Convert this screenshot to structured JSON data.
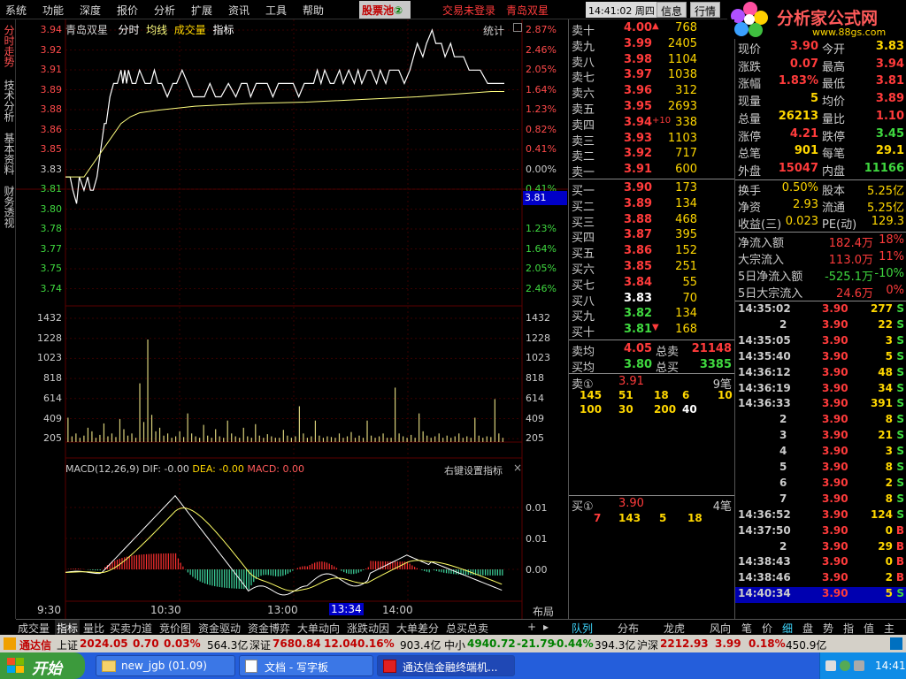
{
  "menu": [
    "系统",
    "功能",
    "深度",
    "报价",
    "分析",
    "扩展",
    "资讯",
    "工具",
    "帮助"
  ],
  "stockpool": "股票池",
  "stockpool_badge": "②",
  "trade_status": "交易未登录",
  "stock_name": "青岛双星",
  "clock": "14:41:02 周四",
  "toolbar": [
    "信息",
    "行情"
  ],
  "logo": {
    "text": "分析家公式网",
    "url": "www.88gs.com"
  },
  "side_tabs": [
    "分时走势",
    "技术分析",
    "基本资料",
    "财务透视"
  ],
  "chart": {
    "name": "青岛双星",
    "mode": "分时",
    "avg": "均线",
    "vol": "成交量",
    "ind": "指标",
    "stat": "统计",
    "left_axis": [
      "3.94",
      "3.92",
      "3.91",
      "3.89",
      "3.88",
      "3.86",
      "3.85",
      "3.83",
      "3.81",
      "3.80",
      "3.78",
      "3.77",
      "3.75",
      "3.74"
    ],
    "right_axis": [
      "2.87%",
      "2.46%",
      "2.05%",
      "1.64%",
      "1.23%",
      "0.82%",
      "0.41%",
      "0.00%",
      "0.41%",
      "0.82%",
      "1.23%",
      "1.64%",
      "2.05%",
      "2.46%"
    ],
    "cursor_price": "3.81",
    "vol_axis": [
      "1432",
      "1228",
      "1023",
      "818",
      "614",
      "409",
      "205"
    ],
    "macd_label": "MACD(12,26,9)",
    "dif": "DIF: -0.00",
    "dea": "DEA: -0.00",
    "macd": "MACD: 0.00",
    "right_click": "右键设置指标",
    "macd_axis": [
      "0.01",
      "0.01",
      "0.00"
    ],
    "time_axis": [
      "9:30",
      "10:30",
      "13:00",
      "13:34",
      "14:00"
    ],
    "layout": "布局"
  },
  "chart_data": {
    "type": "line",
    "price_x": [
      0,
      5,
      8,
      12,
      15,
      20,
      24,
      27,
      30,
      34,
      36,
      38,
      40,
      42,
      44,
      46,
      48,
      52,
      56,
      60,
      62,
      64,
      66,
      68,
      72,
      76,
      80,
      86,
      92,
      96,
      100,
      104,
      110,
      116,
      120,
      126,
      132,
      138,
      144,
      150,
      156,
      162,
      168,
      176,
      184,
      190,
      196,
      200,
      206,
      212,
      218,
      224,
      230,
      236,
      240,
      246,
      252,
      258,
      262,
      268,
      272,
      276,
      280,
      286,
      290,
      296,
      300,
      306,
      312,
      316,
      320,
      326,
      330,
      336,
      340,
      346,
      350,
      356,
      360,
      366,
      372,
      376,
      380,
      386,
      390,
      396,
      400,
      406,
      410,
      416,
      420,
      426,
      430,
      436,
      440,
      448,
      456,
      474
    ],
    "price_y": [
      3.83,
      3.83,
      3.82,
      3.81,
      3.83,
      3.82,
      3.83,
      3.82,
      3.82,
      3.83,
      3.84,
      3.85,
      3.86,
      3.87,
      3.87,
      3.88,
      3.89,
      3.9,
      3.9,
      3.91,
      3.9,
      3.91,
      3.9,
      3.91,
      3.9,
      3.9,
      3.91,
      3.9,
      3.9,
      3.91,
      3.9,
      3.9,
      3.89,
      3.9,
      3.9,
      3.91,
      3.9,
      3.89,
      3.89,
      3.89,
      3.9,
      3.89,
      3.89,
      3.9,
      3.89,
      3.9,
      3.9,
      3.89,
      3.9,
      3.9,
      3.9,
      3.89,
      3.9,
      3.9,
      3.9,
      3.9,
      3.89,
      3.9,
      3.9,
      3.9,
      3.91,
      3.9,
      3.91,
      3.9,
      3.9,
      3.91,
      3.9,
      3.91,
      3.9,
      3.91,
      3.9,
      3.91,
      3.91,
      3.9,
      3.91,
      3.9,
      3.91,
      3.91,
      3.91,
      3.9,
      3.91,
      3.92,
      3.93,
      3.92,
      3.93,
      3.94,
      3.93,
      3.93,
      3.92,
      3.93,
      3.92,
      3.92,
      3.92,
      3.91,
      3.91,
      3.91,
      3.9,
      3.9
    ],
    "avg_x": [
      0,
      10,
      20,
      30,
      40,
      50,
      60,
      70,
      80,
      100,
      140,
      200,
      260,
      320,
      380,
      420,
      460,
      474
    ],
    "avg_y": [
      3.83,
      3.83,
      3.83,
      3.84,
      3.85,
      3.86,
      3.87,
      3.875,
      3.878,
      3.88,
      3.883,
      3.885,
      3.886,
      3.888,
      3.89,
      3.892,
      3.894,
      3.894
    ],
    "ylim": [
      3.74,
      3.94
    ],
    "volume": [
      340,
      80,
      120,
      60,
      90,
      200,
      150,
      60,
      100,
      260,
      80,
      120,
      70,
      320,
      180,
      90,
      120,
      60,
      820,
      280,
      1432,
      380,
      150,
      200,
      90,
      120,
      60,
      80,
      150,
      70,
      400,
      120,
      80,
      60,
      240,
      90,
      60,
      180,
      80,
      60,
      300,
      120,
      80,
      60,
      200,
      80,
      60,
      250,
      90,
      60,
      110,
      80,
      60,
      60,
      170,
      90,
      60,
      80,
      500,
      120,
      60,
      80,
      300,
      90,
      60,
      80,
      70,
      60,
      120,
      60,
      80,
      140,
      60,
      90,
      60,
      300,
      90,
      60,
      80,
      120,
      60,
      60,
      760,
      120,
      80,
      60,
      100,
      60,
      400,
      150,
      90,
      60,
      80,
      120,
      60,
      90,
      60,
      80,
      120,
      60,
      80,
      60,
      340,
      90,
      60,
      80,
      70,
      600,
      120,
      60
    ],
    "vol_max": 1432
  },
  "asks": [
    {
      "label": "卖十",
      "price": "4.00",
      "vol": "768",
      "extra": "▲"
    },
    {
      "label": "卖九",
      "price": "3.99",
      "vol": "2405",
      "extra": ""
    },
    {
      "label": "卖八",
      "price": "3.98",
      "vol": "1104",
      "extra": ""
    },
    {
      "label": "卖七",
      "price": "3.97",
      "vol": "1038",
      "extra": ""
    },
    {
      "label": "卖六",
      "price": "3.96",
      "vol": "312",
      "extra": ""
    },
    {
      "label": "卖五",
      "price": "3.95",
      "vol": "2693",
      "extra": ""
    },
    {
      "label": "卖四",
      "price": "3.94",
      "vol": "338",
      "extra": "+10"
    },
    {
      "label": "卖三",
      "price": "3.93",
      "vol": "1103",
      "extra": ""
    },
    {
      "label": "卖二",
      "price": "3.92",
      "vol": "717",
      "extra": ""
    },
    {
      "label": "卖一",
      "price": "3.91",
      "vol": "600",
      "extra": ""
    }
  ],
  "bids": [
    {
      "label": "买一",
      "price": "3.90",
      "vol": "173",
      "extra": ""
    },
    {
      "label": "买二",
      "price": "3.89",
      "vol": "134",
      "extra": ""
    },
    {
      "label": "买三",
      "price": "3.88",
      "vol": "468",
      "extra": ""
    },
    {
      "label": "买四",
      "price": "3.87",
      "vol": "395",
      "extra": ""
    },
    {
      "label": "买五",
      "price": "3.86",
      "vol": "152",
      "extra": ""
    },
    {
      "label": "买六",
      "price": "3.85",
      "vol": "251",
      "extra": ""
    },
    {
      "label": "买七",
      "price": "3.84",
      "vol": "55",
      "extra": ""
    },
    {
      "label": "买八",
      "price": "3.83",
      "vol": "70",
      "extra": ""
    },
    {
      "label": "买九",
      "price": "3.82",
      "vol": "134",
      "extra": ""
    },
    {
      "label": "买十",
      "price": "3.81",
      "vol": "168",
      "extra": "▼"
    }
  ],
  "avg_sell": {
    "label": "卖均",
    "price": "4.05",
    "tlabel": "总卖",
    "total": "21148"
  },
  "avg_buy": {
    "label": "买均",
    "price": "3.80",
    "tlabel": "总买",
    "total": "3385"
  },
  "sell1_queue": {
    "label": "卖①",
    "price": "3.91",
    "count": "9笔",
    "row1": [
      "145",
      "51",
      "18",
      "6",
      "10"
    ],
    "row2": [
      "100",
      "30",
      "200",
      "40"
    ]
  },
  "buy1_queue": {
    "label": "买①",
    "price": "3.90",
    "count": "4笔",
    "row1": [
      "7",
      "143",
      "5",
      "18"
    ]
  },
  "info": [
    {
      "l1": "现价",
      "v1": "3.90",
      "l2": "今开",
      "v2": "3.83"
    },
    {
      "l1": "涨跌",
      "v1": "0.07",
      "l2": "最高",
      "v2": "3.94"
    },
    {
      "l1": "涨幅",
      "v1": "1.83%",
      "l2": "最低",
      "v2": "3.81"
    },
    {
      "l1": "现量",
      "v1": "5",
      "l2": "均价",
      "v2": "3.89"
    },
    {
      "l1": "总量",
      "v1": "26213",
      "l2": "量比",
      "v2": "1.10"
    },
    {
      "l1": "涨停",
      "v1": "4.21",
      "l2": "跌停",
      "v2": "3.45"
    },
    {
      "l1": "总笔",
      "v1": "901",
      "l2": "每笔",
      "v2": "29.1"
    },
    {
      "l1": "外盘",
      "v1": "15047",
      "l2": "内盘",
      "v2": "11166"
    }
  ],
  "info2": [
    {
      "l1": "换手",
      "v1": "0.50%",
      "l2": "股本",
      "v2": "5.25亿"
    },
    {
      "l1": "净资",
      "v1": "2.93",
      "l2": "流通",
      "v2": "5.25亿"
    },
    {
      "l1": "收益(三)",
      "v1": "0.023",
      "l2": "PE(动)",
      "v2": "129.3"
    }
  ],
  "flow": [
    {
      "l": "净流入额",
      "v": "182.4万",
      "p": "18%"
    },
    {
      "l": "大宗流入",
      "v": "113.0万",
      "p": "11%"
    },
    {
      "l": "5日净流入额",
      "v": "-525.1万",
      "p": "-10%"
    },
    {
      "l": "5日大宗流入",
      "v": "24.6万",
      "p": "0%"
    }
  ],
  "ticks": [
    {
      "t": "14:35:02",
      "p": "3.90",
      "v": "277",
      "s": "S"
    },
    {
      "t": "2",
      "p": "3.90",
      "v": "22",
      "s": "S"
    },
    {
      "t": "14:35:05",
      "p": "3.90",
      "v": "3",
      "s": "S"
    },
    {
      "t": "14:35:40",
      "p": "3.90",
      "v": "5",
      "s": "S"
    },
    {
      "t": "14:36:12",
      "p": "3.90",
      "v": "48",
      "s": "S"
    },
    {
      "t": "14:36:19",
      "p": "3.90",
      "v": "34",
      "s": "S"
    },
    {
      "t": "14:36:33",
      "p": "3.90",
      "v": "391",
      "s": "S"
    },
    {
      "t": "2",
      "p": "3.90",
      "v": "8",
      "s": "S"
    },
    {
      "t": "3",
      "p": "3.90",
      "v": "21",
      "s": "S"
    },
    {
      "t": "4",
      "p": "3.90",
      "v": "3",
      "s": "S"
    },
    {
      "t": "5",
      "p": "3.90",
      "v": "8",
      "s": "S"
    },
    {
      "t": "6",
      "p": "3.90",
      "v": "2",
      "s": "S"
    },
    {
      "t": "7",
      "p": "3.90",
      "v": "8",
      "s": "S"
    },
    {
      "t": "14:36:52",
      "p": "3.90",
      "v": "124",
      "s": "S"
    },
    {
      "t": "14:37:50",
      "p": "3.90",
      "v": "0",
      "s": "B"
    },
    {
      "t": "2",
      "p": "3.90",
      "v": "29",
      "s": "B"
    },
    {
      "t": "14:38:43",
      "p": "3.90",
      "v": "0",
      "s": "B"
    },
    {
      "t": "14:38:46",
      "p": "3.90",
      "v": "2",
      "s": "B"
    },
    {
      "t": "14:40:34",
      "p": "3.90",
      "v": "5",
      "s": "S"
    }
  ],
  "bottom_tabs": [
    "成交量",
    "指标",
    "量比",
    "买卖力道",
    "竞价图",
    "资金驱动",
    "资金博弈",
    "大单动向",
    "涨跌动因",
    "大单差分",
    "总买总卖"
  ],
  "bottom_tabs2": [
    "队列",
    "分布",
    "龙虎",
    "风向"
  ],
  "bottom_tabs3": [
    "笔",
    "价",
    "细",
    "盘",
    "势",
    "指",
    "值",
    "主"
  ],
  "status": {
    "brand": "通达信",
    "sh_l": "上证",
    "sh_v": "2024.05",
    "sh_c": "0.70",
    "sh_p": "0.03%",
    "sh_a": "564.3亿",
    "sz_l": "深证",
    "sz_v": "7680.84",
    "sz_c": "12.04",
    "sz_p": "0.16%",
    "sz_a": "903.4亿",
    "zx_l": "中小",
    "zx_v": "4940.72",
    "zx_c": "-21.79",
    "zx_p": "-0.44%",
    "zx_a": "394.3亿",
    "hs_l": "沪深",
    "hs_v": "2212.93",
    "hs_c": "3.99",
    "hs_p": "0.18%",
    "hs_a": "450.9亿"
  },
  "taskbar": {
    "start": "开始",
    "items": [
      "new_jgb (01.09)",
      "文档 - 写字板",
      "通达信金融终端机..."
    ],
    "time": "14:41"
  }
}
